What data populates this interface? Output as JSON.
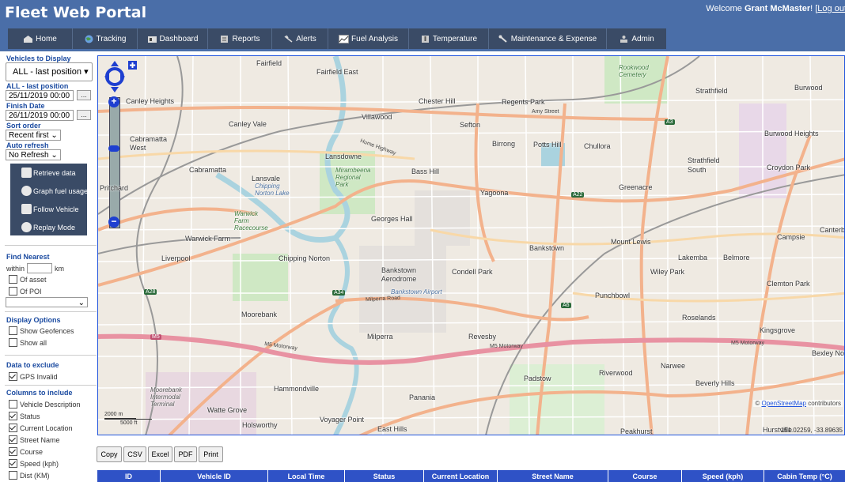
{
  "header": {
    "title": "Fleet Web Portal",
    "welcome_prefix": "Welcome ",
    "user_name": "Grant McMaster",
    "welcome_suffix": "! [",
    "logout_label": "Log out"
  },
  "nav": {
    "items": [
      {
        "label": "Home",
        "icon": "home-icon"
      },
      {
        "label": "Tracking",
        "icon": "globe-icon"
      },
      {
        "label": "Dashboard",
        "icon": "dashboard-icon"
      },
      {
        "label": "Reports",
        "icon": "reports-icon"
      },
      {
        "label": "Alerts",
        "icon": "alerts-icon"
      },
      {
        "label": "Fuel Analysis",
        "icon": "chart-icon"
      },
      {
        "label": "Temperature",
        "icon": "thermometer-icon"
      },
      {
        "label": "Maintenance & Expense",
        "icon": "wrench-icon"
      },
      {
        "label": "Admin",
        "icon": "people-icon"
      }
    ]
  },
  "sidebar": {
    "vehicles_label": "Vehicles to Display",
    "vehicles_value": "ALL - last position",
    "last_position_label": "ALL - last position",
    "start_date": "25/11/2019 00:00",
    "finish_label": "Finish Date",
    "finish_date": "26/11/2019 00:00",
    "date_button": "...",
    "sort_label": "Sort order",
    "sort_value": "Recent first",
    "refresh_label": "Auto refresh",
    "refresh_value": "No Refresh",
    "actions": {
      "retrieve": "Retrieve data",
      "graph": "Graph fuel usage",
      "follow": "Follow Vehicle",
      "replay": "Replay Mode"
    },
    "find_nearest_label": "Find Nearest",
    "within_label": "within",
    "km_label": "km",
    "of_asset": "Of asset",
    "of_poi": "Of POI",
    "display_options_label": "Display Options",
    "show_geofences": "Show Geofences",
    "show_all": "Show all",
    "exclude_label": "Data to exclude",
    "gps_invalid": "GPS Invalid",
    "columns_label": "Columns to include",
    "columns": [
      {
        "label": "Vehicle Description",
        "checked": false
      },
      {
        "label": "Status",
        "checked": true
      },
      {
        "label": "Current Location",
        "checked": true
      },
      {
        "label": "Street Name",
        "checked": true
      },
      {
        "label": "Course",
        "checked": true
      },
      {
        "label": "Speed (kph)",
        "checked": true
      },
      {
        "label": "Dist (KM)",
        "checked": false
      }
    ]
  },
  "map": {
    "credit_prefix": "© ",
    "credit_link": "OpenStreetMap",
    "credit_suffix": " contributors",
    "coords": "151.02259, -33.89635",
    "scale_m": "2000 m",
    "scale_ft": "5000 ft",
    "suburbs": [
      "Fairfield",
      "Fairfield East",
      "Chester Hill",
      "Regents Park",
      "Strathfield",
      "Burwood",
      "Canley Heights",
      "Canley Vale",
      "Villawood",
      "Sefton",
      "Birrong",
      "Potts Hill",
      "Chullora",
      "Burwood Heights",
      "Cabramatta West",
      "Cabramatta",
      "Lansdowne",
      "Bass Hill",
      "Strathfield South",
      "Croydon Park",
      "Lansvale",
      "Yagoona",
      "Greenacre",
      "Georges Hall",
      "Mount Lewis",
      "Campsie",
      "Warwick Farm",
      "Liverpool",
      "Chipping Norton",
      "Bankstown",
      "Lakemba",
      "Belmore",
      "Condell Park",
      "Bankstown Aerodrome",
      "Wiley Park",
      "Clemton Park",
      "Punchbowl",
      "Moorebank",
      "Roselands",
      "Kingsgrove",
      "Milperra",
      "Revesby",
      "Narwee",
      "Riverwood",
      "Beverly Hills",
      "Hammondville",
      "Padstow",
      "Watte Grove",
      "Voyager Point",
      "Panania",
      "Holsworthy",
      "East Hills",
      "Peakhurst",
      "Hurstville",
      "Bexley No",
      "Canterb",
      "Pritchard",
      "Lakemba"
    ],
    "roads": [
      "M5",
      "M5 Motorway",
      "A28",
      "A34",
      "A22",
      "A6",
      "A3",
      "Milperra Road",
      "Hume Highway",
      "Amy Street",
      "Rookwood Cemetery",
      "Mirambeena Regional Park",
      "Warwick Farm Racecourse",
      "Moorebank Intermodal Terminal",
      "Chipping Norton Lake",
      "Bankstown Airport"
    ]
  },
  "export": [
    "Copy",
    "CSV",
    "Excel",
    "PDF",
    "Print"
  ],
  "table": {
    "columns": [
      "ID",
      "Vehicle ID",
      "Local Time",
      "Status",
      "Current Location",
      "Street Name",
      "Course",
      "Speed (kph)",
      "Cabin Temp (°C)"
    ]
  }
}
